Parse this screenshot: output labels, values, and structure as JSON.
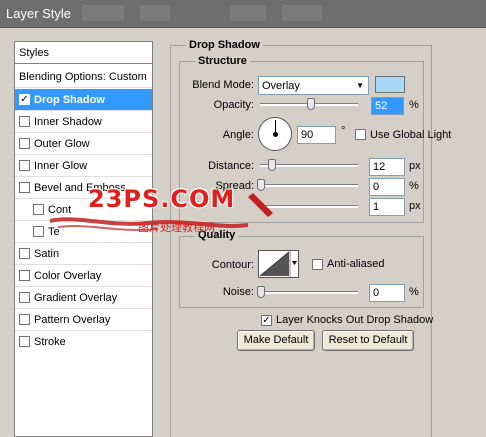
{
  "window": {
    "title": "Layer Style"
  },
  "left_panel": {
    "header": "Styles",
    "items": [
      {
        "label": "Blending Options: Custom",
        "checkbox": false
      },
      {
        "label": "Drop Shadow",
        "checkbox": true,
        "checked": true,
        "selected": true
      },
      {
        "label": "Inner Shadow",
        "checkbox": true,
        "checked": false
      },
      {
        "label": "Outer Glow",
        "checkbox": true,
        "checked": false
      },
      {
        "label": "Inner Glow",
        "checkbox": true,
        "checked": false
      },
      {
        "label": "Bevel and Emboss",
        "checkbox": true,
        "checked": false
      },
      {
        "label": "Cont",
        "checkbox": true,
        "checked": false,
        "sub": true
      },
      {
        "label": "Te",
        "checkbox": true,
        "checked": false,
        "sub": true
      },
      {
        "label": "Satin",
        "checkbox": true,
        "checked": false
      },
      {
        "label": "Color Overlay",
        "checkbox": true,
        "checked": false
      },
      {
        "label": "Gradient Overlay",
        "checkbox": true,
        "checked": false
      },
      {
        "label": "Pattern Overlay",
        "checkbox": true,
        "checked": false
      },
      {
        "label": "Stroke",
        "checkbox": true,
        "checked": false
      }
    ]
  },
  "drop_shadow": {
    "section_title": "Drop Shadow",
    "structure": {
      "title": "Structure",
      "blend_mode_label": "Blend Mode:",
      "blend_mode_value": "Overlay",
      "color_swatch": "#a8d8f8",
      "opacity_label": "Opacity:",
      "opacity_value": "52",
      "opacity_unit": "%",
      "opacity_level": 0.52,
      "angle_label": "Angle:",
      "angle_value": "90",
      "angle_unit": "°",
      "global_light_label": "Use Global Light",
      "distance_label": "Distance:",
      "distance_value": "12",
      "distance_unit": "px",
      "spread_label": "Spread:",
      "spread_value": "0",
      "spread_unit": "%",
      "size_value": "1",
      "size_unit": "px"
    },
    "quality": {
      "title": "Quality",
      "contour_label": "Contour:",
      "anti_aliased_label": "Anti-aliased",
      "noise_label": "Noise:",
      "noise_value": "0",
      "noise_unit": "%"
    },
    "knockout_label": "Layer Knocks Out Drop Shadow",
    "make_default": "Make Default",
    "reset_default": "Reset to Default"
  },
  "watermark": {
    "text": "23PS.COM",
    "subtext": "图片处理教程网",
    "color": "#e0201c"
  }
}
